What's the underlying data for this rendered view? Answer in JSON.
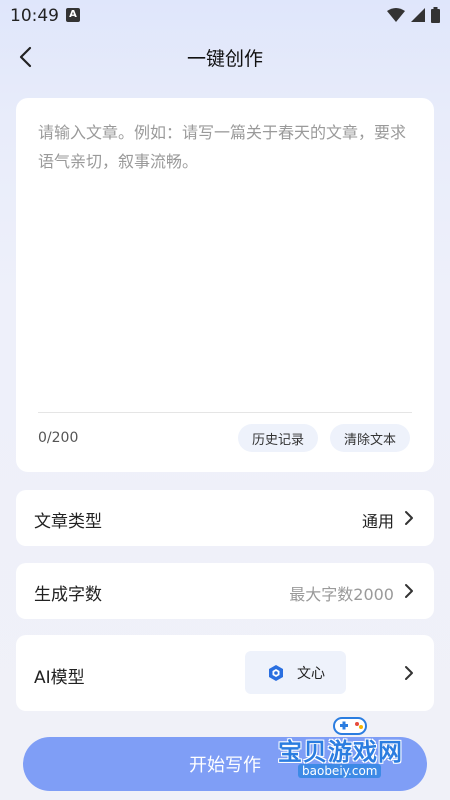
{
  "status_bar": {
    "time": "10:49",
    "app_badge": "A"
  },
  "header": {
    "title": "一键创作"
  },
  "editor": {
    "placeholder": "请输入文章。例如：请写一篇关于春天的文章，要求语气亲切，叙事流畅。",
    "value": "",
    "char_count": "0/200",
    "history_label": "历史记录",
    "clear_label": "清除文本"
  },
  "options": {
    "article_type": {
      "label": "文章类型",
      "value": "通用"
    },
    "word_count": {
      "label": "生成字数",
      "value": "最大字数2000"
    },
    "ai_model": {
      "label": "AI模型",
      "value": "文心"
    }
  },
  "start_button": {
    "label": "开始写作"
  },
  "watermark": {
    "text": "宝贝游戏网",
    "url": "baobeiy.com"
  },
  "colors": {
    "accent": "#7f9ef6",
    "chip_bg": "#eef2fb",
    "watermark_blue": "#2b7de0"
  }
}
